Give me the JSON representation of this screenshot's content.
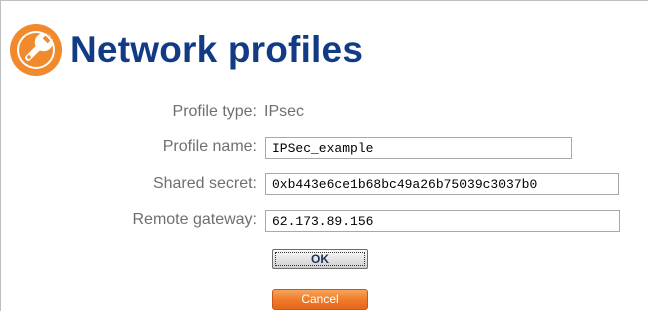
{
  "header": {
    "title": "Network profiles",
    "icon": "wrench-icon",
    "icon_color": "#f08a2c",
    "title_color": "#123b86"
  },
  "form": {
    "profile_type": {
      "label": "Profile type:",
      "value": "IPsec"
    },
    "profile_name": {
      "label": "Profile name:",
      "value": "IPSec_example"
    },
    "shared_secret": {
      "label": "Shared secret:",
      "value": "0xb443e6ce1b68bc49a26b75039c3037b0"
    },
    "remote_gateway": {
      "label": "Remote gateway:",
      "value": "62.173.89.156"
    }
  },
  "buttons": {
    "ok_label": "OK",
    "cancel_label": "Cancel",
    "cancel_color": "#ef7d2a"
  }
}
